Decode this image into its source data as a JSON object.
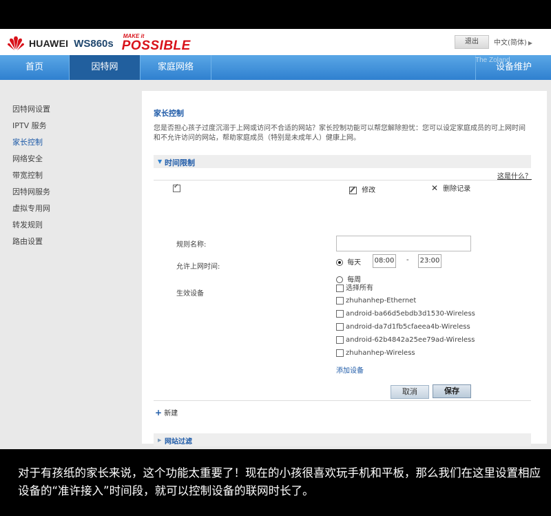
{
  "header": {
    "brand": "HUAWEI",
    "model": "WS860s",
    "slogan_small": "MAKE it",
    "slogan_big": "POSSIBLE",
    "logout_label": "退出",
    "language": "中文(简体)",
    "watermark": "The Zoland"
  },
  "nav": {
    "tabs": [
      {
        "label": "首页"
      },
      {
        "label": "因特网"
      },
      {
        "label": "家庭网络"
      },
      {
        "label": "设备维护"
      }
    ]
  },
  "sidebar": {
    "items": [
      {
        "label": "因特网设置"
      },
      {
        "label": "IPTV 服务"
      },
      {
        "label": "家长控制"
      },
      {
        "label": "网络安全"
      },
      {
        "label": "带宽控制"
      },
      {
        "label": "因特网服务"
      },
      {
        "label": "虚拟专用网"
      },
      {
        "label": "转发规则"
      },
      {
        "label": "路由设置"
      }
    ]
  },
  "main": {
    "title": "家长控制",
    "description": "您是否担心孩子过度沉溺于上网或访问不合适的网站？家长控制功能可以帮您解除担忧：您可以设定家庭成员的可上网时间和不允许访问的网站，帮助家庭成员（特别是未成年人）健康上网。",
    "time_section": "时间限制",
    "help_link": "这是什么？",
    "edit_label": "修改",
    "delete_label": "删除记录",
    "rule_name_label": "规则名称:",
    "rule_name_value": "",
    "allow_time_label": "允许上网时间:",
    "daily_label": "每天",
    "start_time": "08:00",
    "time_dash": "-",
    "end_time": "23:00",
    "weekly_label": "每周",
    "devices_label": "生效设备",
    "select_all_label": "选择所有",
    "devices": [
      {
        "name": "zhuhanhep-Ethernet"
      },
      {
        "name": "android-ba66d5ebdb3d1530-Wireless"
      },
      {
        "name": "android-da7d1fb5cfaeea4b-Wireless"
      },
      {
        "name": "android-62b4842a25ee79ad-Wireless"
      },
      {
        "name": "zhuhanhep-Wireless"
      }
    ],
    "add_device_label": "添加设备",
    "cancel_label": "取消",
    "save_label": "保存",
    "new_label": "新建",
    "web_filter_section": "网站过滤"
  },
  "caption": "对于有孩纸的家长来说，这个功能太重要了！现在的小孩很喜欢玩手机和平板，那么我们在这里设置相应设备的“准许接入”时间段，就可以控制设备的联网时长了。",
  "colors": {
    "nav_blue": "#2f80cf",
    "nav_active": "#215f9e",
    "link_blue": "#1f5ba8",
    "brand_red": "#d8121a"
  }
}
